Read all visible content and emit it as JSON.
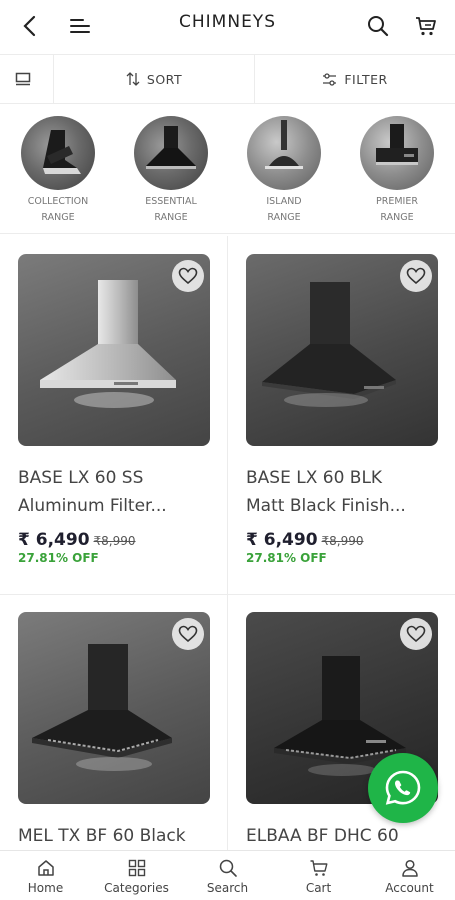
{
  "header": {
    "title": "CHIMNEYS",
    "back_icon": "back-arrow-icon",
    "menu_icon": "menu-icon",
    "search_icon": "search-icon",
    "cart_icon": "cart-icon"
  },
  "toolbar": {
    "view_icon": "grid-view-icon",
    "sort_label": "SORT",
    "filter_label": "FILTER"
  },
  "categories": [
    {
      "line1": "COLLECTION",
      "line2": "RANGE"
    },
    {
      "line1": "ESSENTIAL",
      "line2": "RANGE"
    },
    {
      "line1": "ISLAND",
      "line2": "RANGE"
    },
    {
      "line1": "PREMIER",
      "line2": "RANGE"
    }
  ],
  "products": [
    {
      "name": "BASE LX 60 SS",
      "subtitle": "Aluminum Filter...",
      "price": "₹ 6,490",
      "mrp": "₹8,990",
      "discount": "27.81% OFF"
    },
    {
      "name": "BASE LX 60 BLK",
      "subtitle": "Matt Black Finish...",
      "price": "₹ 6,490",
      "mrp": "₹8,990",
      "discount": "27.81% OFF"
    },
    {
      "name": "MEL TX BF 60 Black",
      "subtitle": "",
      "price": "",
      "mrp": "",
      "discount": ""
    },
    {
      "name": "ELBAA BF DHC 60",
      "subtitle": "",
      "price": "",
      "mrp": "",
      "discount": ""
    }
  ],
  "fab": {
    "icon": "whatsapp-icon",
    "color": "#1fb548"
  },
  "bottom_nav": [
    {
      "label": "Home",
      "icon": "home-icon"
    },
    {
      "label": "Categories",
      "icon": "categories-icon"
    },
    {
      "label": "Search",
      "icon": "search-icon"
    },
    {
      "label": "Cart",
      "icon": "cart-icon"
    },
    {
      "label": "Account",
      "icon": "account-icon"
    }
  ],
  "colors": {
    "discount": "#3aa23a",
    "price": "#1f1f2e",
    "accent": "#1fb548"
  }
}
